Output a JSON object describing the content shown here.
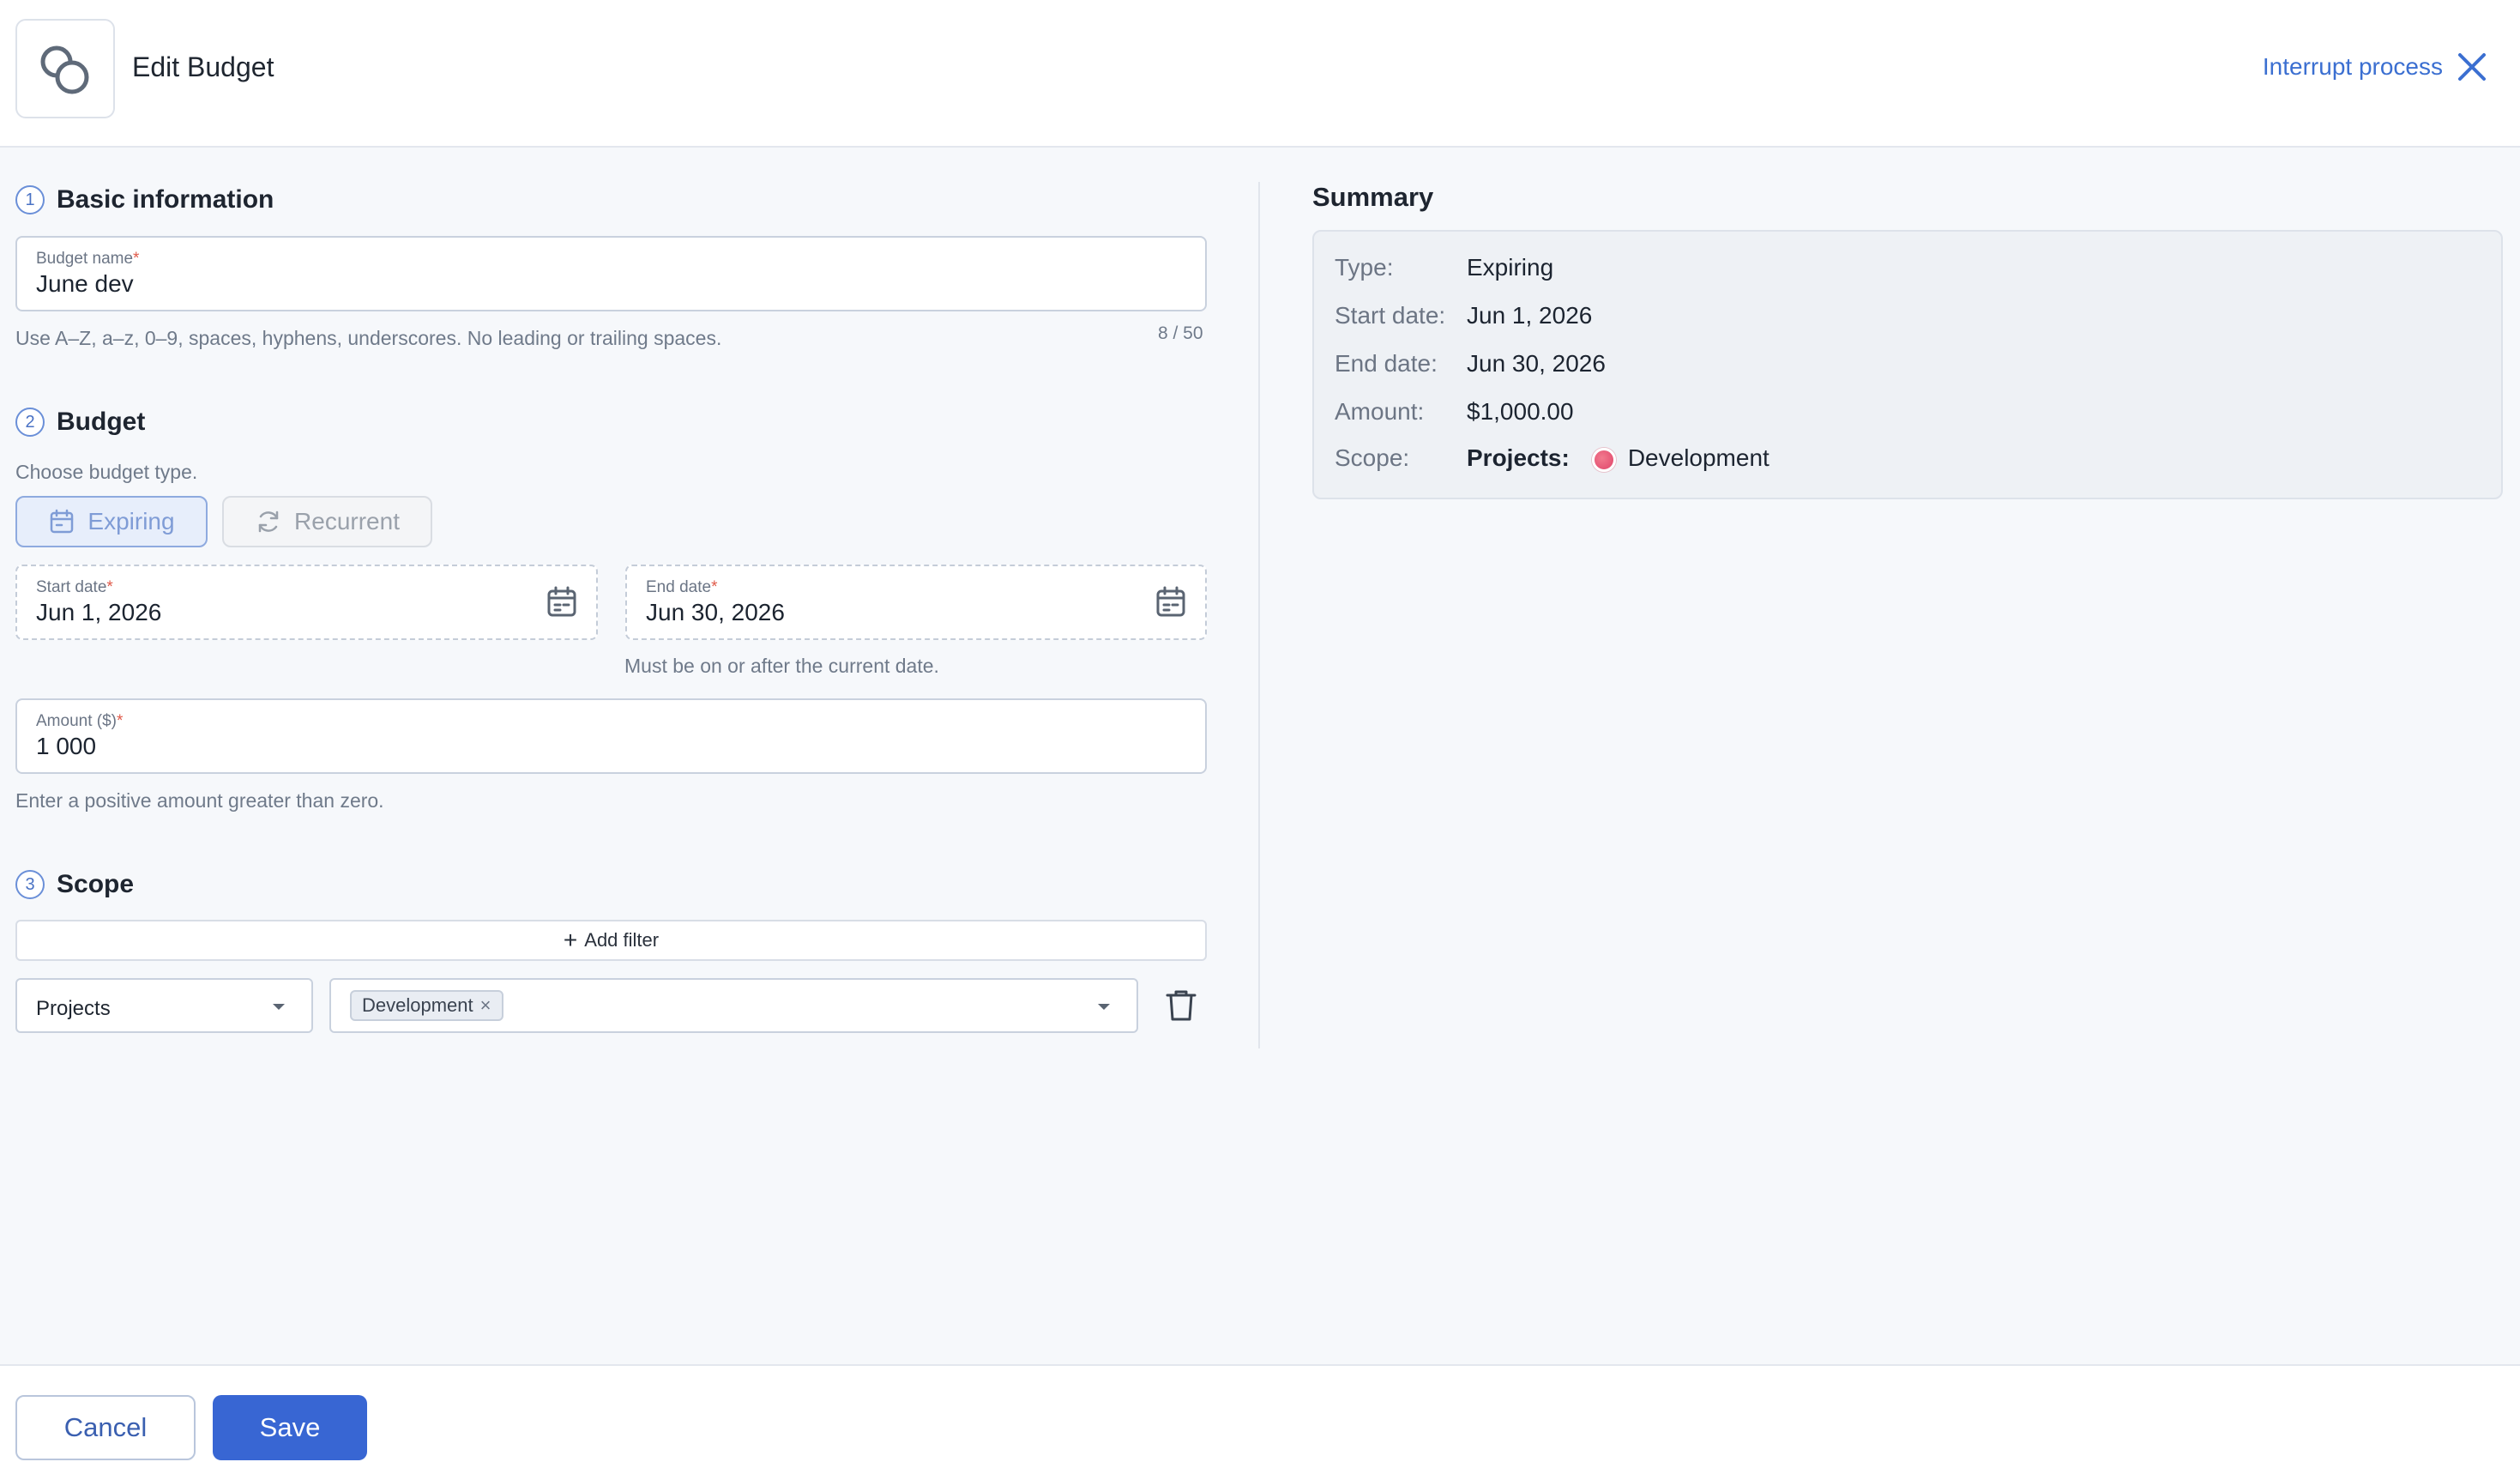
{
  "header": {
    "title": "Edit Budget",
    "interrupt_label": "Interrupt process"
  },
  "sections": {
    "basic": {
      "step": "1",
      "title": "Basic information"
    },
    "budget": {
      "step": "2",
      "title": "Budget"
    },
    "scope": {
      "step": "3",
      "title": "Scope"
    }
  },
  "budget_name": {
    "label": "Budget name",
    "value": "June dev",
    "hint": "Use A–Z, a–z, 0–9, spaces, hyphens, underscores. No leading or trailing spaces.",
    "counter": "8 / 50"
  },
  "budget_type": {
    "prompt": "Choose budget type.",
    "options": [
      "Expiring",
      "Recurrent"
    ],
    "selected": "Expiring"
  },
  "start_date": {
    "label": "Start date",
    "value": "Jun 1, 2026"
  },
  "end_date": {
    "label": "End date",
    "value": "Jun 30, 2026",
    "hint": "Must be on or after the current date."
  },
  "amount": {
    "label": "Amount ($)",
    "value": "1 000",
    "hint": "Enter a positive amount greater than zero."
  },
  "scope": {
    "add_filter_label": "Add filter",
    "filter_type": "Projects",
    "chips": [
      "Development"
    ]
  },
  "summary": {
    "title": "Summary",
    "rows": {
      "type": {
        "key": "Type:",
        "value": "Expiring"
      },
      "start": {
        "key": "Start date:",
        "value": "Jun 1, 2026"
      },
      "end": {
        "key": "End date:",
        "value": "Jun 30, 2026"
      },
      "amount": {
        "key": "Amount:",
        "value": "$1,000.00"
      },
      "scope": {
        "key": "Scope:",
        "category": "Projects:",
        "value": "Development"
      }
    }
  },
  "footer": {
    "cancel_label": "Cancel",
    "save_label": "Save"
  },
  "colors": {
    "accent": "#3866d3",
    "link": "#3b6fd1",
    "required": "#e05a4a",
    "scope_dot": "#e8506f"
  }
}
